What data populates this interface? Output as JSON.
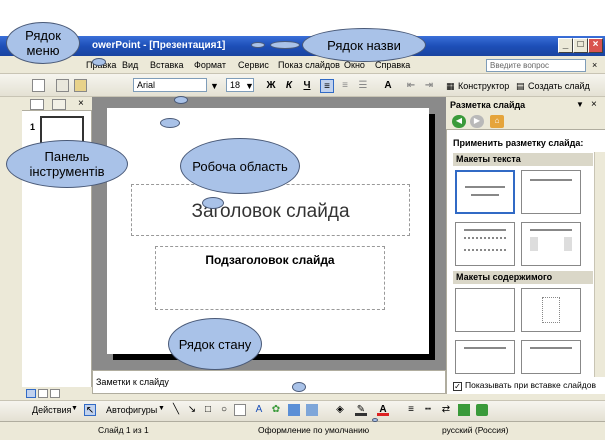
{
  "window": {
    "title": "owerPoint - [Презентация1]",
    "buttons": {
      "minimize": "_",
      "maximize": "□",
      "close": "×"
    }
  },
  "menu": {
    "items": [
      "Правка",
      "Вид",
      "Вставка",
      "Формат",
      "Сервис",
      "Показ слайдов",
      "Окно",
      "Справка"
    ],
    "help_placeholder": "Введите вопрос",
    "close": "×"
  },
  "toolbar": {
    "font": "Arial",
    "size": "18",
    "bold": "Ж",
    "italic": "К",
    "underline": "Ч",
    "designer": "Конструктор",
    "new_slide": "Создать слайд"
  },
  "outline": {
    "close": "×",
    "slide_number": "1"
  },
  "slide": {
    "title_placeholder": "Заголовок слайда",
    "subtitle_placeholder": "Подзаголовок слайда"
  },
  "notes": {
    "placeholder": "Заметки к слайду"
  },
  "taskpane": {
    "title": "Разметка слайда",
    "close": "×",
    "dropdown": "▼",
    "apply_label": "Применить разметку слайда:",
    "section_text": "Макеты текста",
    "section_content": "Макеты содержимого",
    "checkbox_label": "Показывать при вставке слайдов"
  },
  "drawbar": {
    "actions": "Действия",
    "autoshapes": "Автофигуры"
  },
  "status": {
    "slide": "Слайд 1 из 1",
    "design": "Оформление по умолчанию",
    "language": "русский (Россия)"
  },
  "callouts": {
    "menu_row": "Рядок меню",
    "title_row": "Рядок назви",
    "toolbar_panel": "Панель інструментів",
    "work_area": "Робоча область",
    "status_row": "Рядок стану"
  },
  "colors": {
    "titlebar": "#1d4fb8",
    "callout": "#a9c2e8",
    "selection": "#316ac5"
  }
}
